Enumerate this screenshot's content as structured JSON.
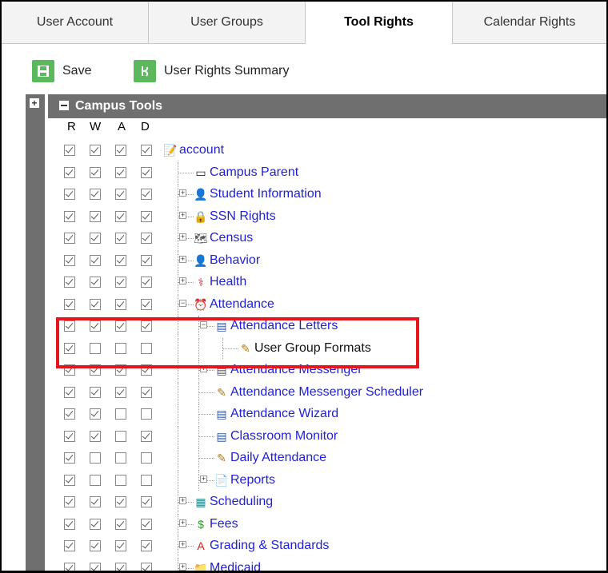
{
  "tabs": [
    {
      "label": "User Account",
      "active": false
    },
    {
      "label": "User Groups",
      "active": false
    },
    {
      "label": "Tool Rights",
      "active": true
    },
    {
      "label": "Calendar Rights",
      "active": false
    }
  ],
  "toolbar": {
    "save_label": "Save",
    "summary_label": "User Rights Summary",
    "save_icon": "save-icon",
    "summary_icon": "rights-summary-icon"
  },
  "campus_tools": {
    "title": "Campus Tools",
    "columns": [
      "R",
      "W",
      "A",
      "D"
    ]
  },
  "colors": {
    "header_bg": "#6f6f6f",
    "link": "#1f1fd6",
    "highlight": "#e8141c",
    "button_green": "#5cb85c"
  },
  "tree": [
    {
      "label": "account",
      "depth": 0,
      "expander": "none",
      "icon": "account-edit-icon",
      "rights": [
        1,
        1,
        1,
        1
      ]
    },
    {
      "label": "Campus Parent",
      "depth": 1,
      "expander": "none",
      "icon": "window-icon",
      "rights": [
        1,
        1,
        1,
        1
      ]
    },
    {
      "label": "Student Information",
      "depth": 1,
      "expander": "plus",
      "icon": "student-icon",
      "rights": [
        1,
        1,
        1,
        1
      ]
    },
    {
      "label": "SSN Rights",
      "depth": 1,
      "expander": "plus",
      "icon": "lock-icon",
      "rights": [
        1,
        1,
        1,
        1
      ]
    },
    {
      "label": "Census",
      "depth": 1,
      "expander": "plus",
      "icon": "census-icon",
      "rights": [
        1,
        1,
        1,
        1
      ]
    },
    {
      "label": "Behavior",
      "depth": 1,
      "expander": "plus",
      "icon": "behavior-icon",
      "rights": [
        1,
        1,
        1,
        1
      ]
    },
    {
      "label": "Health",
      "depth": 1,
      "expander": "plus",
      "icon": "health-icon",
      "rights": [
        1,
        1,
        1,
        1
      ]
    },
    {
      "label": "Attendance",
      "depth": 1,
      "expander": "minus",
      "icon": "attendance-icon",
      "rights": [
        1,
        1,
        1,
        1
      ]
    },
    {
      "label": "Attendance Letters",
      "depth": 2,
      "expander": "minus",
      "icon": "windows-icon",
      "rights": [
        1,
        1,
        1,
        1
      ]
    },
    {
      "label": "User Group Formats",
      "depth": 3,
      "expander": "none",
      "icon": "edit-icon",
      "rights": [
        1,
        0,
        0,
        0
      ],
      "dark": true
    },
    {
      "label": "Attendance Messenger",
      "depth": 2,
      "expander": "plus",
      "icon": "windows-icon",
      "rights": [
        1,
        1,
        1,
        1
      ]
    },
    {
      "label": "Attendance Messenger Scheduler",
      "depth": 2,
      "expander": "none",
      "icon": "edit-icon",
      "rights": [
        1,
        1,
        1,
        1
      ]
    },
    {
      "label": "Attendance Wizard",
      "depth": 2,
      "expander": "none",
      "icon": "windows-icon",
      "rights": [
        1,
        1,
        0,
        0
      ]
    },
    {
      "label": "Classroom Monitor",
      "depth": 2,
      "expander": "none",
      "icon": "windows-icon",
      "rights": [
        1,
        1,
        0,
        1
      ]
    },
    {
      "label": "Daily Attendance",
      "depth": 2,
      "expander": "none",
      "icon": "edit-icon",
      "rights": [
        1,
        0,
        0,
        0
      ]
    },
    {
      "label": "Reports",
      "depth": 2,
      "expander": "plus",
      "icon": "document-icon",
      "rights": [
        1,
        0,
        0,
        0
      ]
    },
    {
      "label": "Scheduling",
      "depth": 1,
      "expander": "plus",
      "icon": "scheduling-icon",
      "rights": [
        1,
        1,
        1,
        1
      ]
    },
    {
      "label": "Fees",
      "depth": 1,
      "expander": "plus",
      "icon": "dollar-icon",
      "rights": [
        1,
        1,
        1,
        1
      ]
    },
    {
      "label": "Grading & Standards",
      "depth": 1,
      "expander": "plus",
      "icon": "grading-icon",
      "rights": [
        1,
        1,
        1,
        1
      ]
    },
    {
      "label": "Medicaid",
      "depth": 1,
      "expander": "plus",
      "icon": "folder-icon",
      "rights": [
        1,
        1,
        1,
        1
      ]
    }
  ]
}
